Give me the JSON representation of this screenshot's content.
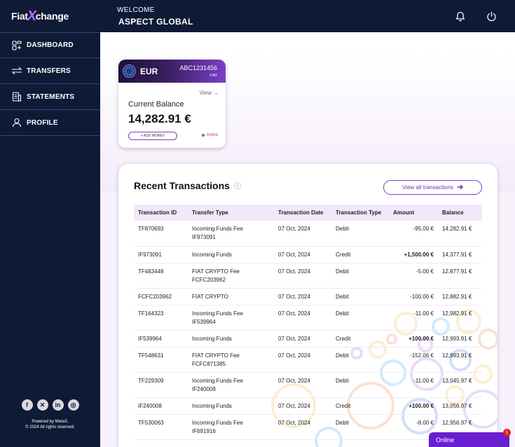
{
  "brand": {
    "logo_left": "Fiat",
    "logo_x": "X",
    "logo_right": "change"
  },
  "header": {
    "welcome_label": "WELCOME",
    "user_name": "ASPECT GLOBAL"
  },
  "nav": [
    {
      "label": "DASHBOARD",
      "icon": "dashboard-icon"
    },
    {
      "label": "TRANSFERS",
      "icon": "transfer-arrows-icon"
    },
    {
      "label": "STATEMENTS",
      "icon": "statements-icon"
    },
    {
      "label": "PROFILE",
      "icon": "user-icon"
    }
  ],
  "socials": [
    {
      "glyph": "f",
      "icon": "facebook-icon"
    },
    {
      "glyph": "✕",
      "icon": "x-icon"
    },
    {
      "glyph": "in",
      "icon": "linkedin-icon"
    },
    {
      "glyph": "◎",
      "icon": "instagram-icon"
    }
  ],
  "footer": {
    "powered": "Powered by MetaX,",
    "rights": "© 2024 All rights reserved."
  },
  "account": {
    "currency": "EUR",
    "account_number": "ABC1231456",
    "account_type": "FIAT",
    "view_label": "View →",
    "balance_label": "Current Balance",
    "balance": "14,282.91 €",
    "add_money_label": "+ ADD MONEY",
    "status": "Active"
  },
  "transactions": {
    "title": "Recent Transactions",
    "view_all_label": "View all transactions",
    "columns": [
      "Transaction ID",
      "Transfer Type",
      "Transaction Date",
      "Transaction Type",
      "Amount",
      "Balance"
    ],
    "rows": [
      {
        "id": "TF870693",
        "transfer": "Incoming Funds Fee",
        "ref": "IF973091",
        "date": "07 Oct, 2024",
        "type": "Debit",
        "amount": "-95.00 €",
        "balance": "14,282.91 €"
      },
      {
        "id": "IF973091",
        "transfer": "Incoming Funds",
        "ref": "",
        "date": "07 Oct, 2024",
        "type": "Credit",
        "amount": "+1,500.00 €",
        "balance": "14,377.91 €"
      },
      {
        "id": "TF483448",
        "transfer": "FIAT CRYPTO Fee",
        "ref": "FCFC203962",
        "date": "07 Oct, 2024",
        "type": "Debit",
        "amount": "-5.00 €",
        "balance": "12,877.91 €"
      },
      {
        "id": "FCFC203962",
        "transfer": "FIAT CRYPTO",
        "ref": "",
        "date": "07 Oct, 2024",
        "type": "Debit",
        "amount": "-100.00 €",
        "balance": "12,882.91 €"
      },
      {
        "id": "TF164323",
        "transfer": "Incoming Funds Fee",
        "ref": "IF539964",
        "date": "07 Oct, 2024",
        "type": "Debit",
        "amount": "-11.00 €",
        "balance": "12,982.91 €"
      },
      {
        "id": "IF539964",
        "transfer": "Incoming Funds",
        "ref": "",
        "date": "07 Oct, 2024",
        "type": "Credit",
        "amount": "+100.00 €",
        "balance": "12,993.91 €"
      },
      {
        "id": "TF548631",
        "transfer": "FIAT CRYPTO Fee",
        "ref": "FCFC871385",
        "date": "07 Oct, 2024",
        "type": "Debit",
        "amount": "-152.06 €",
        "balance": "12,893.91 €"
      },
      {
        "id": "TF229309",
        "transfer": "Incoming Funds Fee",
        "ref": "IF240008",
        "date": "07 Oct, 2024",
        "type": "Debit",
        "amount": "-11.00 €",
        "balance": "13,045.97 €"
      },
      {
        "id": "IF240008",
        "transfer": "Incoming Funds",
        "ref": "",
        "date": "07 Oct, 2024",
        "type": "Credit",
        "amount": "+100.00 €",
        "balance": "13,056.97 €"
      },
      {
        "id": "TF530063",
        "transfer": "Incoming Funds Fee",
        "ref": "IF691916",
        "date": "07 Oct, 2024",
        "type": "Debit",
        "amount": "-8.00 €",
        "balance": "12,956.97 €"
      }
    ]
  },
  "chat": {
    "label": "Online",
    "badge": "1"
  },
  "colors": {
    "sidebar": "#0e1a36",
    "accent": "#7a3ec8",
    "header_row": "#f1e8fb",
    "chat": "#6a1fd1"
  }
}
